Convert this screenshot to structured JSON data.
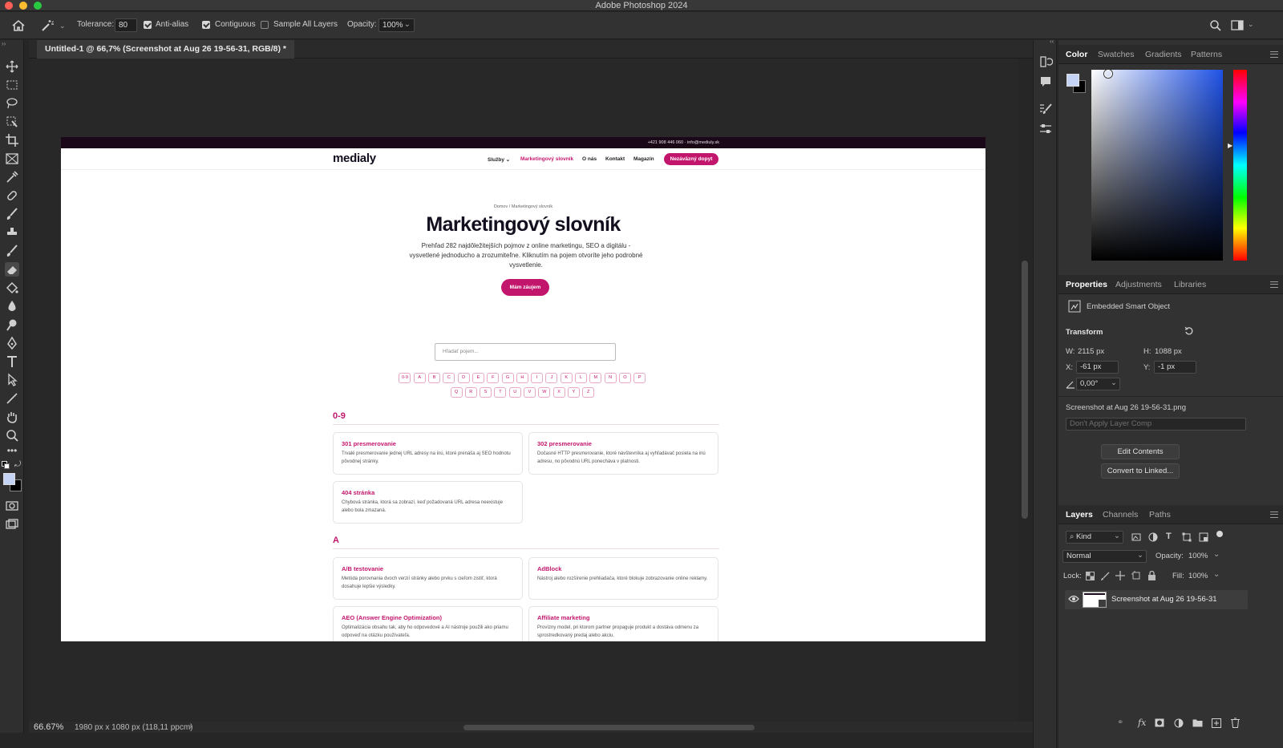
{
  "app": {
    "title": "Adobe Photoshop 2024"
  },
  "options_bar": {
    "tolerance_label": "Tolerance:",
    "tolerance_value": "80",
    "anti_alias_label": "Anti-alias",
    "anti_alias_checked": true,
    "contiguous_label": "Contiguous",
    "contiguous_checked": true,
    "sample_all_layers_label": "Sample All Layers",
    "sample_all_layers_checked": false,
    "opacity_label": "Opacity:",
    "opacity_value": "100%"
  },
  "document_tab": {
    "label": "Untitled-1 @ 66,7% (Screenshot at Aug 26 19-56-31, RGB/8) *"
  },
  "status_bar": {
    "zoom": "66.67%",
    "info": "1980 px x 1080 px (118,11 ppcm)"
  },
  "canvas_page": {
    "top_strip": "+421 908 446 060  ·  info@mediuly.sk",
    "logo": "medialy",
    "nav": [
      {
        "label": "Služby ⌄",
        "active": false
      },
      {
        "label": "Marketingový slovník",
        "active": true
      },
      {
        "label": "O nás",
        "active": false
      },
      {
        "label": "Kontakt",
        "active": false
      },
      {
        "label": "Magazín",
        "active": false
      }
    ],
    "nav_cta": "Nezáväzný dopyt",
    "breadcrumb": "Domov  /  Marketingový slovník",
    "heading": "Marketingový slovník",
    "lead": "Prehľad 282 najdôležitejších pojmov z online marketingu, SEO a digitálu - vysvetlené jednoducho a zrozumiteľne. Kliknutím na pojem otvoríte jeho podrobné vysvetlenie.",
    "hero_button": "Mám záujem",
    "search_placeholder": "Hľadať pojem...",
    "letters_row1": [
      "0-9",
      "A",
      "B",
      "C",
      "D",
      "E",
      "F",
      "G",
      "H",
      "I",
      "J",
      "K",
      "L",
      "M",
      "N",
      "O",
      "P"
    ],
    "letters_row2": [
      "Q",
      "R",
      "S",
      "T",
      "U",
      "V",
      "W",
      "X",
      "Y",
      "Z"
    ],
    "sections": [
      {
        "heading": "0-9",
        "cards": [
          {
            "title": "301 presmerovanie",
            "desc": "Trvalé presmerovanie jednej URL adresy na inú, ktoré prenáša aj SEO hodnotu pôvodnej stránky."
          },
          {
            "title": "302 presmerovanie",
            "desc": "Dočasné HTTP presmerovanie, ktoré návštevníka aj vyhľadávač posiela na inú adresu, no pôvodnú URL ponecháva v platnosti."
          },
          {
            "title": "404 stránka",
            "desc": "Chybová stránka, ktorá sa zobrazí, keď požadovaná URL adresa neexistuje alebo bola zmazaná."
          }
        ]
      },
      {
        "heading": "A",
        "cards": [
          {
            "title": "A/B testovanie",
            "desc": "Metóda porovnania dvoch verzií stránky alebo prvku s cieľom zistiť, ktorá dosahuje lepšie výsledky."
          },
          {
            "title": "AdBlock",
            "desc": "Nástroj alebo rozšírenie prehliadača, ktoré blokuje zobrazovanie online reklamy."
          },
          {
            "title": "AEO (Answer Engine Optimization)",
            "desc": "Optimalizácia obsahu tak, aby ho odpovedové a AI nástroje použili ako priamu odpoveď na otázku používateľa."
          },
          {
            "title": "Affiliate marketing",
            "desc": "Provízny model, pri ktorom partner propaguje produkt a dostáva odmenu za sprostredkovaný predaj alebo akciu."
          }
        ]
      }
    ]
  },
  "color_panel": {
    "tabs": [
      "Color",
      "Swatches",
      "Gradients",
      "Patterns"
    ],
    "active_tab": "Color",
    "foreground_color": "#c5d3f5",
    "hue_color": "#1f52e6"
  },
  "properties_panel": {
    "tabs": [
      "Properties",
      "Adjustments",
      "Libraries"
    ],
    "active_tab": "Properties",
    "object_type": "Embedded Smart Object",
    "transform_label": "Transform",
    "w_label": "W:",
    "w_value": "2115 px",
    "h_label": "H:",
    "h_value": "1088 px",
    "x_label": "X:",
    "x_value": "-61 px",
    "y_label": "Y:",
    "y_value": "-1 px",
    "angle_value": "0,00°",
    "file_name": "Screenshot at Aug 26 19-56-31.png",
    "layer_comp": "Don't Apply Layer Comp",
    "edit_contents": "Edit Contents",
    "convert_linked": "Convert to Linked..."
  },
  "layers_panel": {
    "tabs": [
      "Layers",
      "Channels",
      "Paths"
    ],
    "active_tab": "Layers",
    "filter_kind": "Kind",
    "blend_mode": "Normal",
    "opacity_label": "Opacity:",
    "opacity_value": "100%",
    "lock_label": "Lock:",
    "fill_label": "Fill:",
    "fill_value": "100%",
    "layer_name": "Screenshot at Aug 26 19-56-31"
  },
  "colors": {
    "accent": "#c2166d",
    "ps_bg": "#262626",
    "ps_panel": "#323232"
  }
}
